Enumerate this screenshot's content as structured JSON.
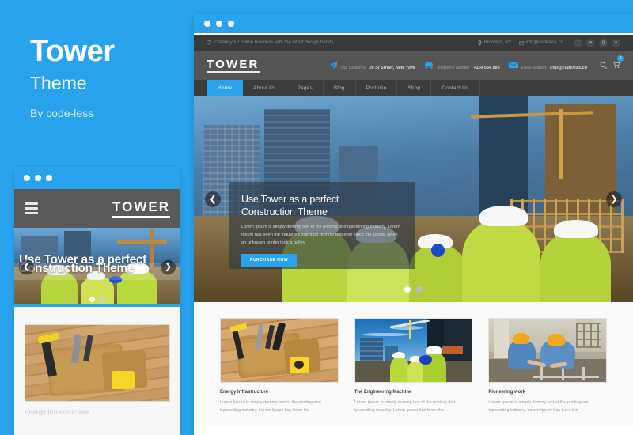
{
  "brand": {
    "title": "Tower",
    "subtitle": "Theme",
    "author": "By code-less",
    "accent_color": "#29a3ed"
  },
  "mobile_preview": {
    "window_dots": [
      "dot",
      "dot",
      "dot"
    ],
    "header": {
      "menu_icon": "hamburger-icon",
      "logo": "TOWER"
    },
    "hero": {
      "headline_line1": "Use Tower as a perfect",
      "headline_line2": "Construction Theme",
      "prev_icon": "chevron-left-icon",
      "next_icon": "chevron-right-icon",
      "dots": 2,
      "active_dot": 0
    },
    "card": {
      "title": "Energy Infrastructure",
      "image_alt": "tool-belt-on-wood"
    }
  },
  "desktop_preview": {
    "window_dots": [
      "dot",
      "dot",
      "dot"
    ],
    "topbar": {
      "tagline_icon": "heart-icon",
      "tagline": "Create your online business with the latest design trends",
      "location_icon": "map-pin-icon",
      "location": "Brooklyn, NY",
      "email_icon": "envelope-icon",
      "email": "info@codeless.co",
      "socials": [
        {
          "name": "facebook-icon",
          "glyph": "f"
        },
        {
          "name": "twitter-icon",
          "glyph": "ᵛ"
        },
        {
          "name": "google-plus-icon",
          "glyph": "g"
        },
        {
          "name": "pinterest-icon",
          "glyph": "p"
        }
      ]
    },
    "inforow": {
      "logo": "TOWER",
      "items": [
        {
          "icon": "paper-plane-icon",
          "label": "Our Locations",
          "value": "20 St Street, New York"
        },
        {
          "icon": "telephone-icon",
          "label": "Telephone Number",
          "value": "+114 554 888"
        },
        {
          "icon": "envelope-icon",
          "label": "Email Address",
          "value": "info@codeless.co"
        }
      ],
      "search_icon": "search-icon",
      "cart_icon": "shopping-cart-icon",
      "cart_count": "0"
    },
    "nav": [
      {
        "label": "Home",
        "active": true
      },
      {
        "label": "About Us",
        "active": false
      },
      {
        "label": "Pages",
        "active": false
      },
      {
        "label": "Blog",
        "active": false
      },
      {
        "label": "Portfolio",
        "active": false
      },
      {
        "label": "Shop",
        "active": false
      },
      {
        "label": "Contact Us",
        "active": false
      }
    ],
    "hero": {
      "headline_line1": "Use Tower as a perfect",
      "headline_line2": "Construction Theme",
      "paragraph": "Lorem Ipsum is simply dummy text of the printing and typesetting industry. Lorem Ipsum has been the industry's standard dummy text ever since the 1500s, when an unknown printer took a galley",
      "button_label": "PURCHASE NOW",
      "prev_icon": "chevron-left-icon",
      "next_icon": "chevron-right-icon",
      "dots": 2,
      "active_dot": 0
    },
    "cards": [
      {
        "title": "Energy Infrastructure",
        "desc": "Lorem Ipsum is simply dummy text of the printing and typesetting industry. Lorem Ipsum has been the",
        "image_alt": "tool-belt-on-wood"
      },
      {
        "title": "The Engineering Machine",
        "desc": "Lorem Ipsum is simply dummy text of the printing and typesetting industry. Lorem Ipsum has been the",
        "image_alt": "workers-looking-up-at-construction-site"
      },
      {
        "title": "Pioneering work",
        "desc": "Lorem Ipsum is simply dummy text of the printing and typesetting industry. Lorem Ipsum has been the",
        "image_alt": "two-workers-building-wall"
      }
    ]
  }
}
